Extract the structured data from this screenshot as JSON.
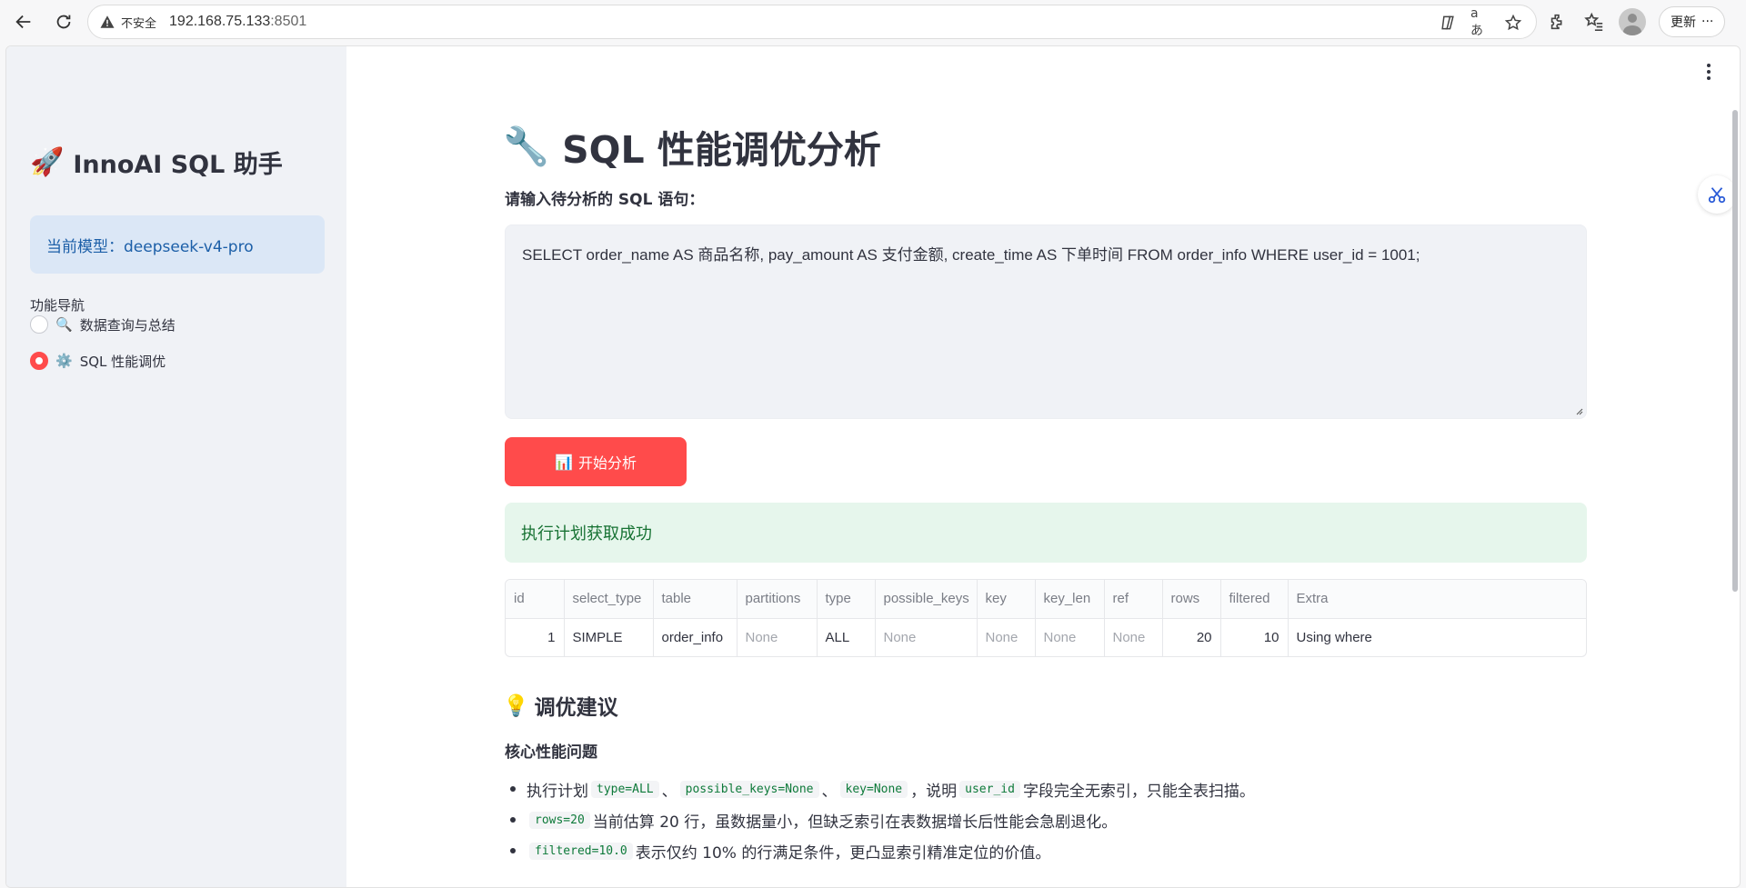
{
  "browser": {
    "insecure_label": "不安全",
    "url_host": "192.168.75.133",
    "url_port": ":8501",
    "update_label": "更新",
    "more_label": "···"
  },
  "sidebar": {
    "title": "InnoAI SQL 助手",
    "model_text": "当前模型：deepseek-v4-pro",
    "nav_label": "功能导航",
    "nav_items": [
      {
        "icon": "🔍",
        "label": "数据查询与总结",
        "selected": false
      },
      {
        "icon": "⚙️",
        "label": "SQL 性能调优",
        "selected": true
      }
    ]
  },
  "main": {
    "title_icon": "🔧",
    "title": "SQL 性能调优分析",
    "input_label": "请输入待分析的 SQL 语句：",
    "sql_value": "SELECT order_name AS 商品名称, pay_amount AS 支付金额, create_time AS 下单时间 FROM order_info WHERE user_id = 1001;",
    "start_button_icon": "📊",
    "start_button": "开始分析",
    "success_msg": "执行计划获取成功",
    "table": {
      "headers": [
        "id",
        "select_type",
        "table",
        "partitions",
        "type",
        "possible_keys",
        "key",
        "key_len",
        "ref",
        "rows",
        "filtered",
        "Extra"
      ],
      "rows": [
        [
          "1",
          "SIMPLE",
          "order_info",
          "None",
          "ALL",
          "None",
          "None",
          "None",
          "None",
          "20",
          "10",
          "Using where"
        ]
      ]
    },
    "suggestion_icon": "💡",
    "suggestion_title": "调优建议",
    "core_title": "核心性能问题",
    "bullets": [
      {
        "pre": "执行计划",
        "c1": "type=ALL",
        "s1": "、",
        "c2": "possible_keys=None",
        "s2": "、",
        "c3": "key=None",
        "mid": "，说明",
        "c4": "user_id",
        "post": "字段完全无索引，只能全表扫描。"
      },
      {
        "c1": "rows=20",
        "post": "当前估算 20 行，虽数据量小，但缺乏索引在表数据增长后性能会急剧退化。"
      },
      {
        "c1": "filtered=10.0",
        "post": "表示仅约 10% 的行满足条件，更凸显索引精准定位的价值。"
      }
    ]
  },
  "colors": {
    "accent": "#ff4b4b",
    "sidebar_bg": "#f0f2f6",
    "model_box_bg": "#dbe7f6",
    "success_bg": "#e6f6ec",
    "success_text": "#177233"
  }
}
